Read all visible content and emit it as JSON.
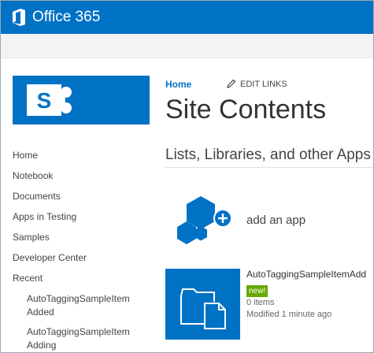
{
  "suite_bar": {
    "product_name": "Office 365",
    "brand_color": "#0072c6"
  },
  "top_links": {
    "home": "Home",
    "edit_links": "EDIT LINKS"
  },
  "page_title": "Site Contents",
  "section_title": "Lists, Libraries, and other Apps",
  "quick_launch": {
    "items": [
      {
        "label": "Home"
      },
      {
        "label": "Notebook"
      },
      {
        "label": "Documents"
      },
      {
        "label": "Apps in Testing"
      },
      {
        "label": "Samples"
      },
      {
        "label": "Developer Center"
      },
      {
        "label": "Recent"
      }
    ],
    "recent": [
      {
        "label": "AutoTaggingSampleItem Added"
      },
      {
        "label": "AutoTaggingSampleItem Adding"
      }
    ]
  },
  "add_app": {
    "label": "add an app",
    "icon": "add-app-icon"
  },
  "apps": [
    {
      "name": "AutoTaggingSampleItemAdd",
      "badge": "new!",
      "items": "0 items",
      "modified": "Modified 1 minute ago",
      "icon": "folder-document-icon"
    }
  ]
}
